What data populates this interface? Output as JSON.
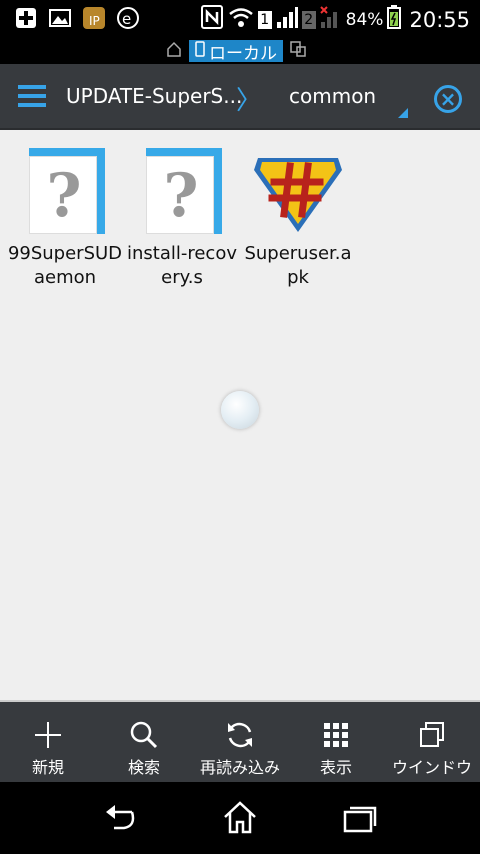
{
  "status_bar": {
    "battery_percent": "84%",
    "time": "20:55",
    "sim1": "1",
    "sim2": "2"
  },
  "location_bar": {
    "storage_label": "ローカル"
  },
  "header": {
    "path_parent": "UPDATE-SuperS...",
    "path_current": "common"
  },
  "files": [
    {
      "name": "99SuperSUDaemon",
      "type": "unknown"
    },
    {
      "name": "install-recovery.s",
      "type": "unknown"
    },
    {
      "name": "Superuser.apk",
      "type": "apk"
    }
  ],
  "toolbar": {
    "new_label": "新規",
    "search_label": "検索",
    "reload_label": "再読み込み",
    "view_label": "表示",
    "window_label": "ウインドウ"
  },
  "colors": {
    "accent": "#37a3e8",
    "header_bg": "#373a3e",
    "background": "#efefef"
  }
}
